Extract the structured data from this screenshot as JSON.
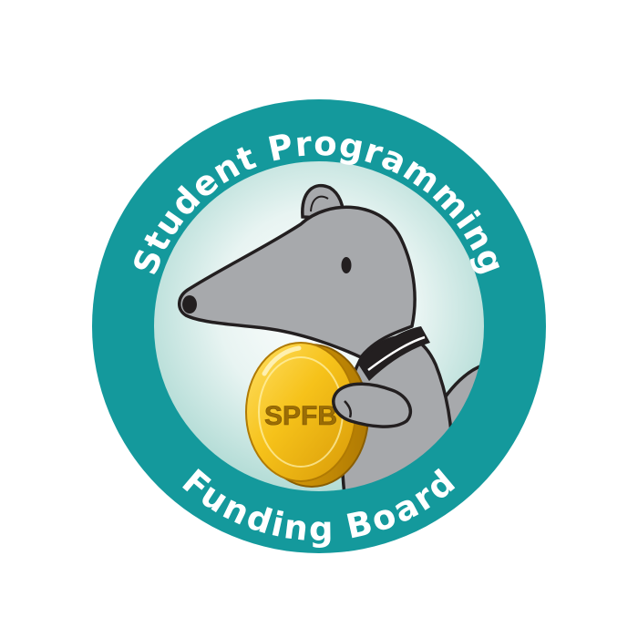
{
  "badge": {
    "top_text": "Student Programming",
    "bottom_text": "Funding Board",
    "coin_label": "SPFB"
  },
  "colors": {
    "ring": "#14999c",
    "inner_bg_center": "#ffffff",
    "inner_bg_edge": "#b3dcd6",
    "anteater_body": "#a7a9ac",
    "anteater_outline": "#231f20",
    "coin_gold": "#f6c21a",
    "coin_dark": "#c48a05",
    "coin_text": "#9b6d05"
  },
  "icons": {
    "mascot": "anteater-icon",
    "coin": "gold-coin-icon"
  }
}
